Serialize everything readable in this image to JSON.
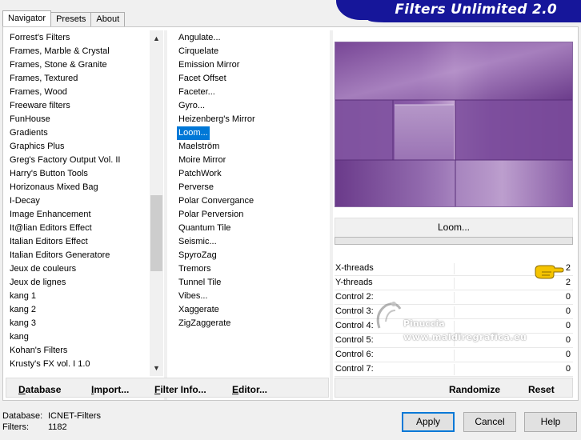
{
  "banner": {
    "title": "Filters Unlimited 2.0"
  },
  "tabs": [
    {
      "label": "Navigator",
      "active": true
    },
    {
      "label": "Presets",
      "active": false
    },
    {
      "label": "About",
      "active": false
    }
  ],
  "categories": [
    "Forrest's Filters",
    "Frames, Marble & Crystal",
    "Frames, Stone & Granite",
    "Frames, Textured",
    "Frames, Wood",
    "Freeware filters",
    "FunHouse",
    "Gradients",
    "Graphics Plus",
    "Greg's Factory Output Vol. II",
    "Harry's Button Tools",
    "Horizonaus Mixed Bag",
    "I-Decay",
    "Image Enhancement",
    "It@lian Editors Effect",
    "Italian Editors Effect",
    "Italian Editors Generatore",
    "Jeux de couleurs",
    "Jeux de lignes",
    "kang 1",
    "kang 2",
    "kang 3",
    "kang",
    "Kohan's Filters",
    "Krusty's FX vol. I 1.0"
  ],
  "filters": [
    "Angulate...",
    "Cirquelate",
    "Emission Mirror",
    "Facet Offset",
    "Faceter...",
    "Gyro...",
    "Heizenberg's Mirror",
    "Loom...",
    "Maelström",
    "Moire Mirror",
    "PatchWork",
    "Perverse",
    "Polar Convergance",
    "Polar Perversion",
    "Quantum Tile",
    "Seismic...",
    "SpyroZag",
    "Tremors",
    "Tunnel Tile",
    "Vibes...",
    "Xaggerate",
    "ZigZaggerate"
  ],
  "selected_filter_index": 7,
  "selected_filter_name": "Loom...",
  "controls": [
    {
      "label": "X-threads",
      "value": "2"
    },
    {
      "label": "Y-threads",
      "value": "2"
    },
    {
      "label": "Control 2:",
      "value": "0"
    },
    {
      "label": "Control 3:",
      "value": "0"
    },
    {
      "label": "Control 4:",
      "value": "0"
    },
    {
      "label": "Control 5:",
      "value": "0"
    },
    {
      "label": "Control 6:",
      "value": "0"
    },
    {
      "label": "Control 7:",
      "value": "0"
    }
  ],
  "watermark": {
    "name": "Pinuccia",
    "url": "www.maldiregrafica.eu"
  },
  "left_buttons": [
    {
      "ul": "D",
      "rest": "atabase"
    },
    {
      "ul": "I",
      "rest": "mport..."
    },
    {
      "ul": "F",
      "rest": "ilter Info..."
    },
    {
      "ul": "E",
      "rest": "ditor..."
    }
  ],
  "right_buttons": {
    "randomize": "Randomize",
    "reset": "Reset"
  },
  "status": {
    "database_label": "Database:",
    "database_value": "ICNET-Filters",
    "filters_label": "Filters:",
    "filters_value": "1182"
  },
  "dialog_buttons": {
    "apply": "Apply",
    "cancel": "Cancel",
    "help": "Help"
  },
  "colors": {
    "selection": "#0078d7",
    "banner": "#16169a",
    "preview_purple": "#7a4a9a"
  }
}
